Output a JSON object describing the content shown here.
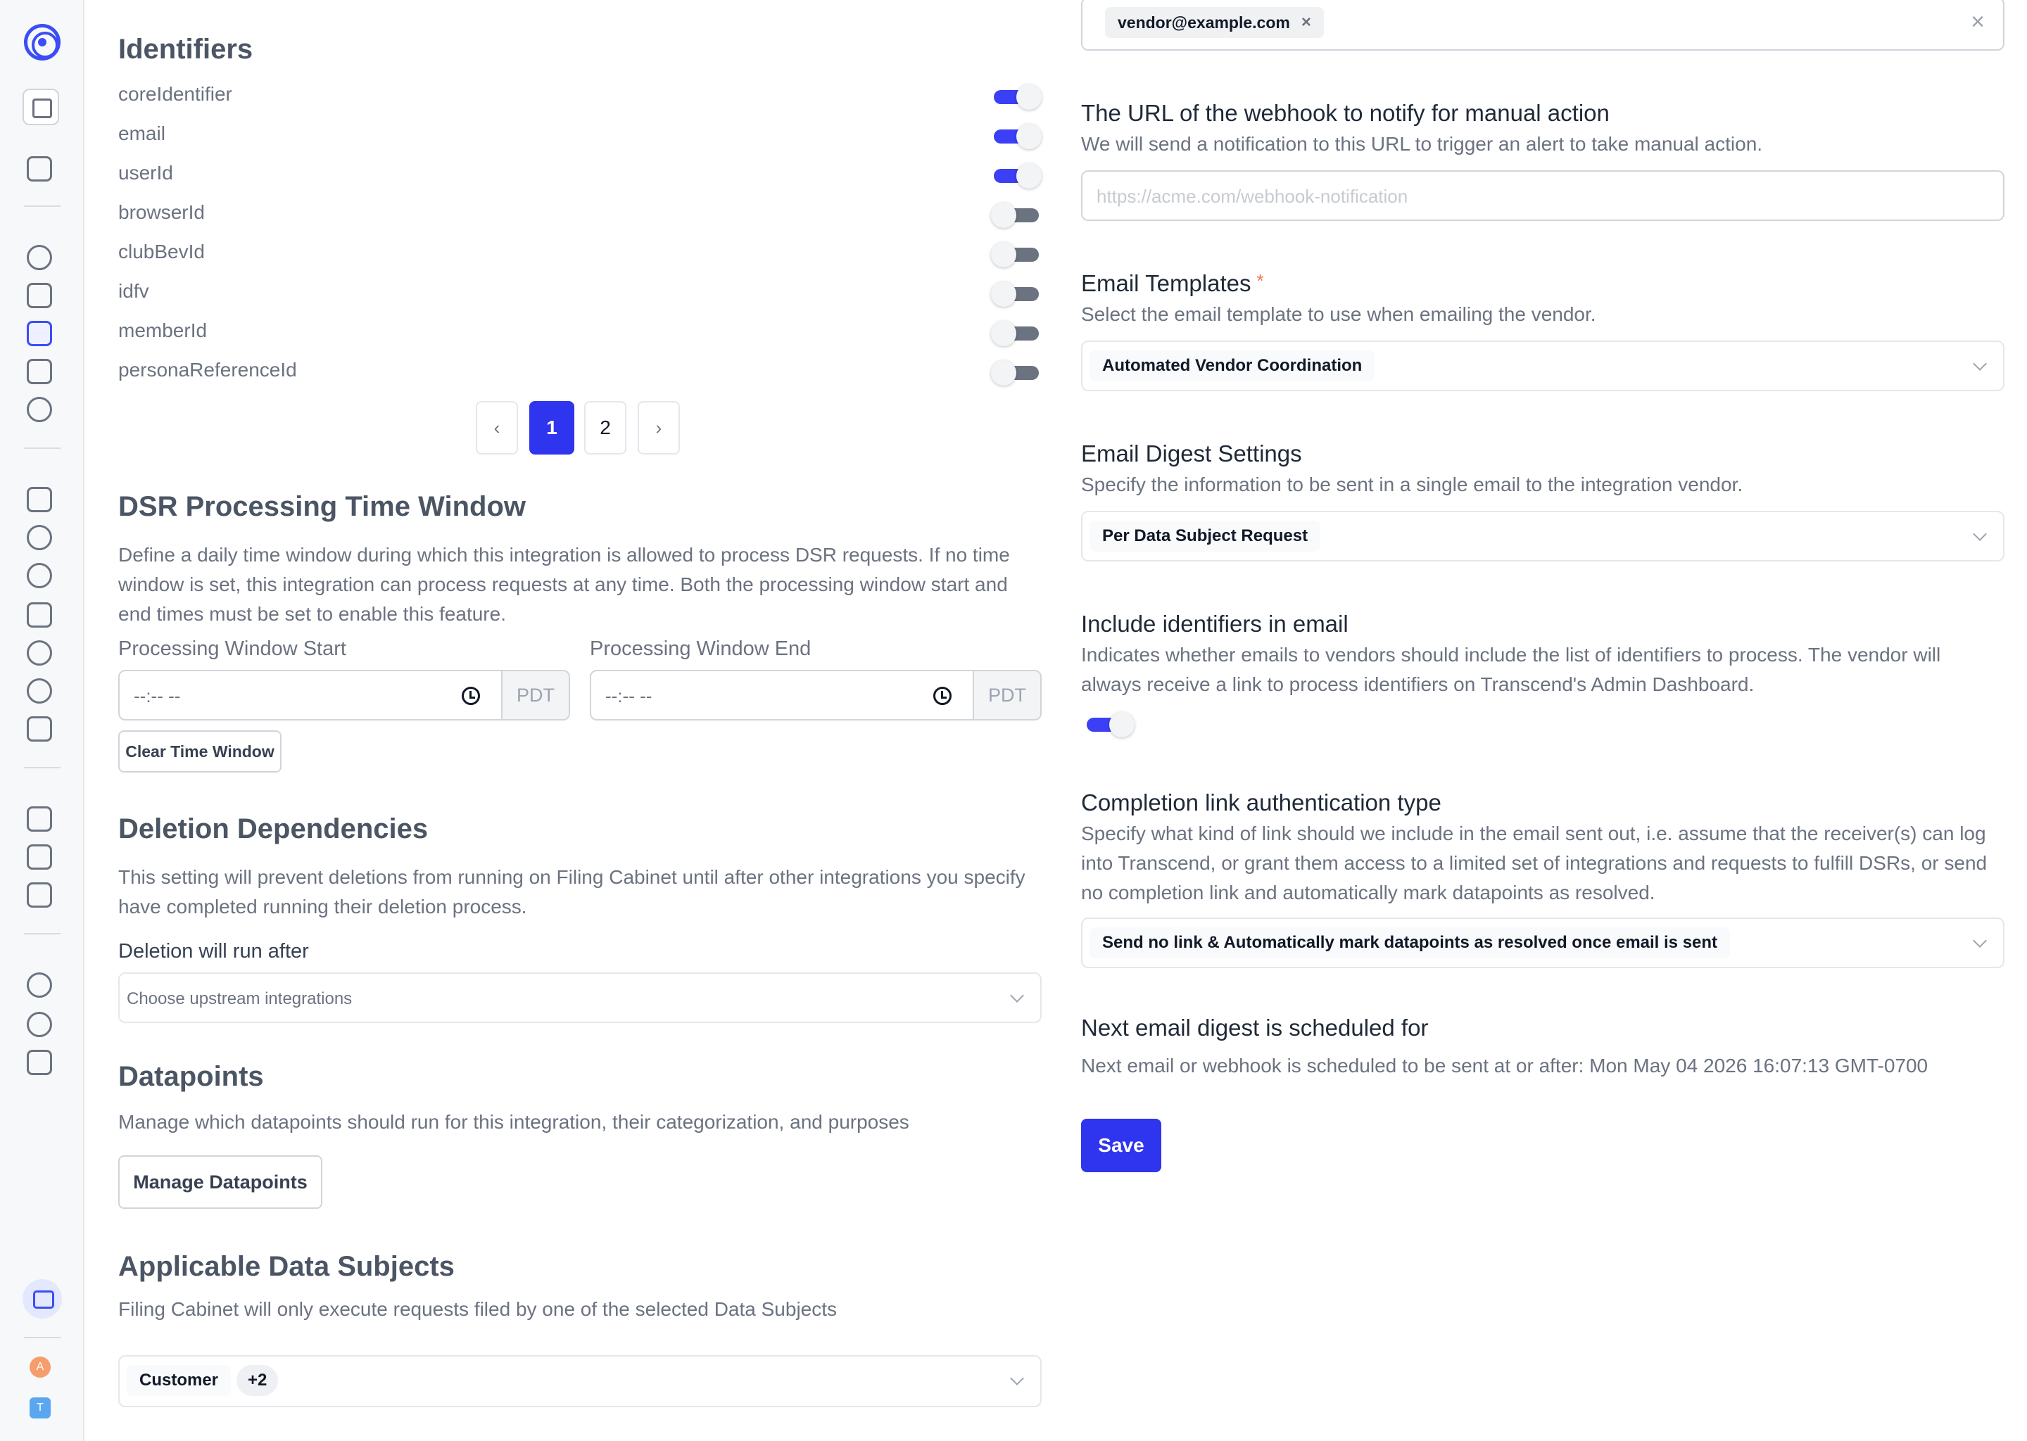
{
  "colors": {
    "accent": "#2f35ee",
    "toggle_on": "#3b3ff5",
    "toggle_off": "#6b7280",
    "required": "#f97352"
  },
  "sidebar": {
    "icons": [
      "logo-icon",
      "activity-icon",
      "clipboard-icon",
      "globe-icon",
      "cube-icon",
      "list-grid-icon",
      "grid-icon",
      "network-icon",
      "apps-icon",
      "link-icon",
      "users-icon",
      "inbox-icon",
      "user-icon",
      "compass-icon",
      "list-add-icon",
      "doc-search-icon",
      "doc-sync-icon",
      "calendar-search-icon",
      "eye-off-icon",
      "gear-icon",
      "presentation-icon",
      "chat-icon"
    ],
    "avatars": [
      "A",
      "T"
    ]
  },
  "identifiers": {
    "title": "Identifiers",
    "items": [
      {
        "name": "coreIdentifier",
        "enabled": true
      },
      {
        "name": "email",
        "enabled": true
      },
      {
        "name": "userId",
        "enabled": true
      },
      {
        "name": "browserId",
        "enabled": false
      },
      {
        "name": "clubBevId",
        "enabled": false
      },
      {
        "name": "idfv",
        "enabled": false
      },
      {
        "name": "memberId",
        "enabled": false
      },
      {
        "name": "personaReferenceId",
        "enabled": false
      }
    ],
    "pagination": {
      "prev": "‹",
      "pages": [
        "1",
        "2"
      ],
      "current": "1",
      "next": "›"
    }
  },
  "dsr_window": {
    "title": "DSR Processing Time Window",
    "description": "Define a daily time window during which this integration is allowed to process DSR requests. If no time window is set, this integration can process requests at any time. Both the processing window start and end times must be set to enable this feature.",
    "start_label": "Processing Window Start",
    "end_label": "Processing Window End",
    "start_value": "--:-- --",
    "end_value": "--:-- --",
    "timezone": "PDT",
    "clear_button": "Clear Time Window"
  },
  "deletion": {
    "title": "Deletion Dependencies",
    "description": "This setting will prevent deletions from running on Filing Cabinet until after other integrations you specify have completed running their deletion process.",
    "field_label": "Deletion will run after",
    "placeholder": "Choose upstream integrations"
  },
  "datapoints": {
    "title": "Datapoints",
    "description": "Manage which datapoints should run for this integration, their categorization, and purposes",
    "button": "Manage Datapoints"
  },
  "data_subjects": {
    "title": "Applicable Data Subjects",
    "description": "Filing Cabinet will only execute requests filed by one of the selected Data Subjects",
    "selected": "Customer",
    "more": "+2"
  },
  "vendor_email": {
    "chip": "vendor@example.com",
    "chip_remove": "×",
    "clear": "×"
  },
  "webhook": {
    "label": "The URL of the webhook to notify for manual action",
    "description": "We will send a notification to this URL to trigger an alert to take manual action.",
    "placeholder": "https://acme.com/webhook-notification",
    "value": ""
  },
  "email_templates": {
    "label": "Email Templates",
    "required": "*",
    "description": "Select the email template to use when emailing the vendor.",
    "selected": "Automated Vendor Coordination"
  },
  "digest": {
    "label": "Email Digest Settings",
    "description": "Specify the information to be sent in a single email to the integration vendor.",
    "selected": "Per Data Subject Request"
  },
  "include_identifiers": {
    "label": "Include identifiers in email",
    "description": "Indicates whether emails to vendors should include the list of identifiers to process. The vendor will always receive a link to process identifiers on Transcend's Admin Dashboard.",
    "enabled": true
  },
  "completion_link": {
    "label": "Completion link authentication type",
    "description": "Specify what kind of link should we include in the email sent out, i.e. assume that the receiver(s) can log into Transcend, or grant them access to a limited set of integrations and requests to fulfill DSRs, or send no completion link and automatically mark datapoints as resolved.",
    "selected": "Send no link & Automatically mark datapoints as resolved once email is sent"
  },
  "next_digest": {
    "label": "Next email digest is scheduled for",
    "text": "Next email or webhook is scheduled to be sent at or after: Mon May 04 2026 16:07:13 GMT-0700"
  },
  "save_button": "Save"
}
